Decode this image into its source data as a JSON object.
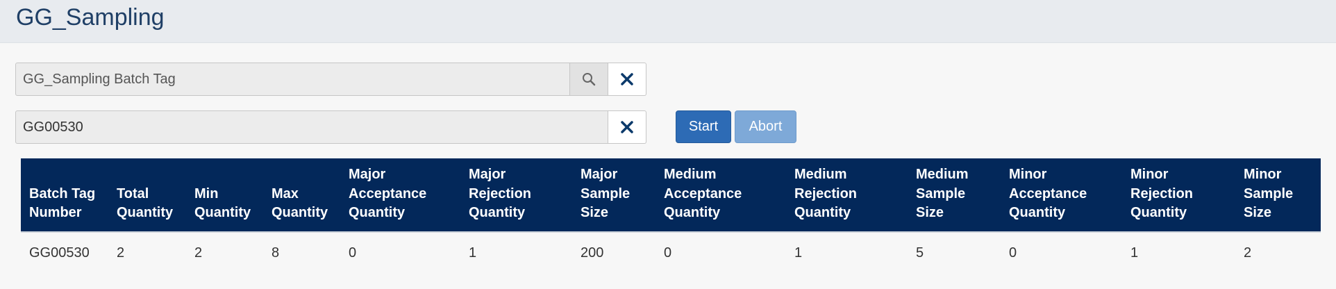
{
  "header": {
    "title": "GG_Sampling"
  },
  "batch_search": {
    "placeholder": "GG_Sampling Batch Tag",
    "search_icon": "search-icon",
    "clear_icon": "close-icon"
  },
  "batch_value": {
    "value": "GG00530",
    "clear_icon": "close-icon"
  },
  "actions": {
    "start_label": "Start",
    "abort_label": "Abort"
  },
  "table": {
    "headers": [
      "Batch Tag Number",
      "Total Quantity",
      "Min Quantity",
      "Max Quantity",
      "Major Acceptance Quantity",
      "Major Rejection Quantity",
      "Major Sample Size",
      "Medium Acceptance Quantity",
      "Medium Rejection Quantity",
      "Medium Sample Size",
      "Minor Acceptance Quantity",
      "Minor Rejection Quantity",
      "Minor Sample Size"
    ],
    "rows": [
      [
        "GG00530",
        "2",
        "2",
        "8",
        "0",
        "1",
        "200",
        "0",
        "1",
        "5",
        "0",
        "1",
        "2"
      ]
    ]
  },
  "colors": {
    "header_bg": "#e8ebef",
    "title": "#1f3f66",
    "table_header_bg": "#03285a",
    "start_bg": "#2d6bb5",
    "abort_bg": "#7ea9d8"
  }
}
